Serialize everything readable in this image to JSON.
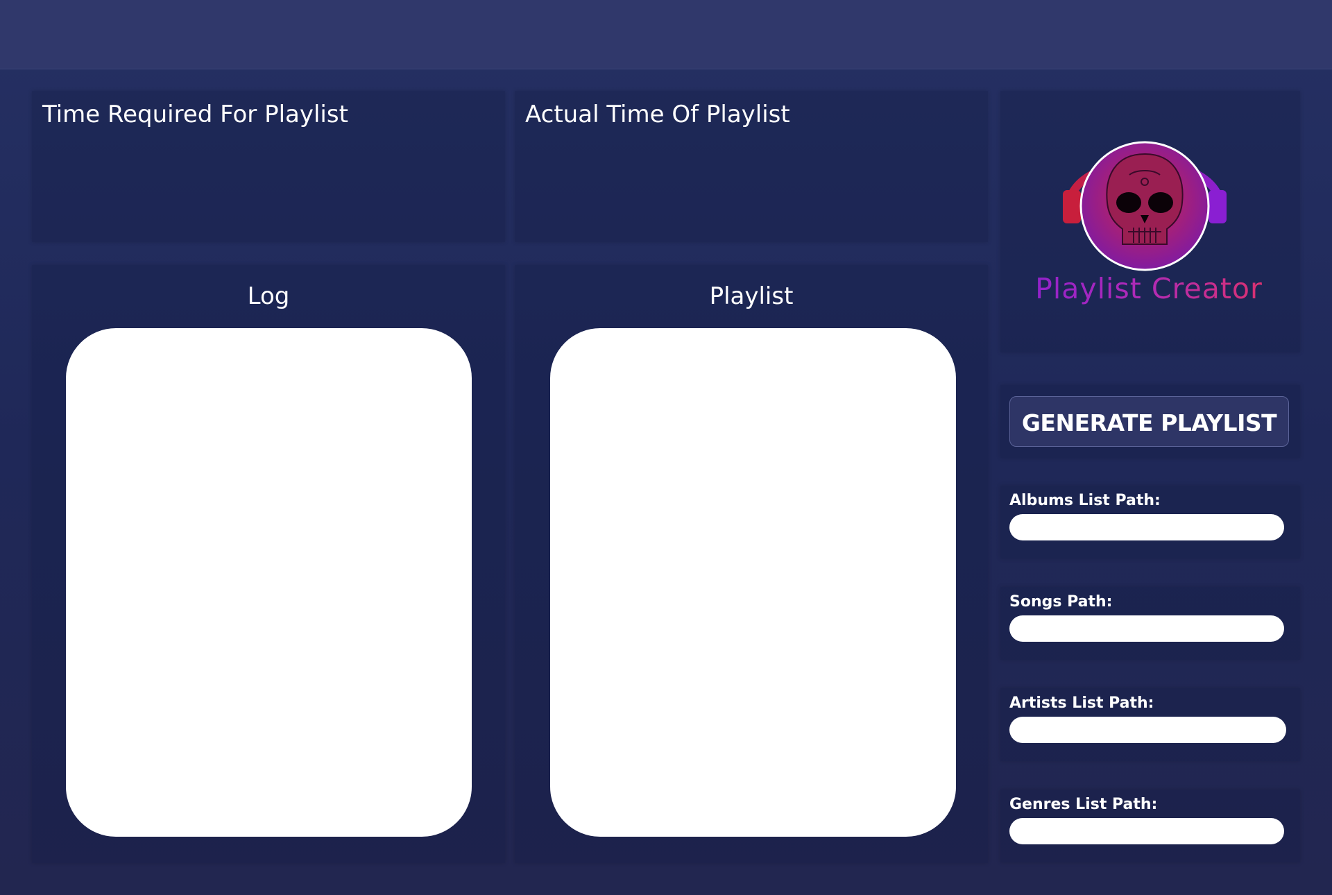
{
  "app": {
    "logo_text": "Playlist Creator"
  },
  "time_required": {
    "title": "Time Required For Playlist"
  },
  "actual_time": {
    "title": "Actual Time Of Playlist"
  },
  "log": {
    "title": "Log"
  },
  "playlist": {
    "title": "Playlist"
  },
  "actions": {
    "generate_label": "GENERATE PLAYLIST"
  },
  "fields": {
    "albums_label": "Albums List Path:",
    "albums_value": "",
    "songs_label": "Songs Path:",
    "songs_value": "",
    "artists_label": "Artists List Path:",
    "artists_value": "",
    "genres_label": "Genres List Path:",
    "genres_value": ""
  },
  "colors": {
    "background": "#222a5c",
    "topbar": "#30386b",
    "button": "#2e3566",
    "logo_gradient_start": "#8a1fd2",
    "logo_gradient_end": "#e6335a"
  },
  "icons": {
    "logo": "skull-headphones-logo"
  }
}
